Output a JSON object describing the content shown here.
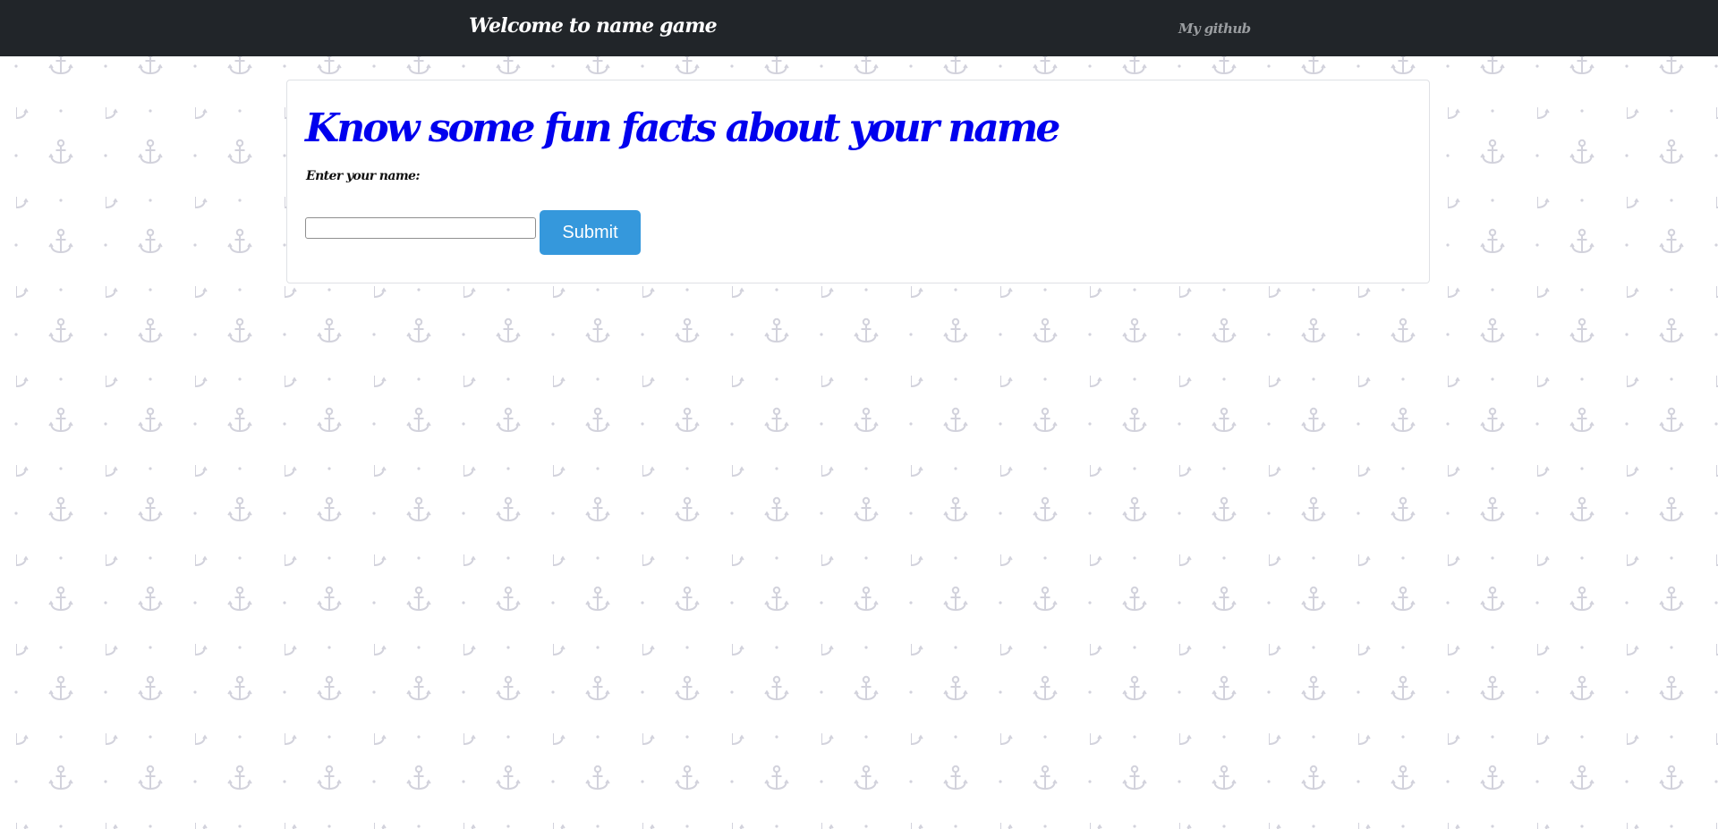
{
  "navbar": {
    "brand": "Welcome to name game",
    "link": "My github"
  },
  "main": {
    "heading": "Know some fun facts about your name",
    "name_label": "Enter your name:",
    "name_input_value": "",
    "submit_label": "Submit"
  },
  "background": {
    "pattern_icon": "anchor-icon",
    "pattern_color": "#d2d2dc"
  },
  "colors": {
    "navbar": "#212529",
    "heading": "#0000ee",
    "button": "#3598dc"
  }
}
